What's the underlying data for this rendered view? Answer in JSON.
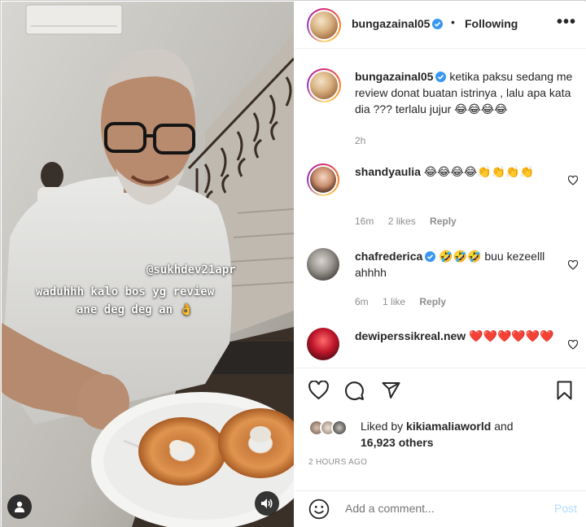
{
  "post": {
    "username": "bungazainal05",
    "follow_status": "Following",
    "dot": "•",
    "more": "•••"
  },
  "media": {
    "overlay_mention": "@sukhdev21apr",
    "overlay_line1": "waduhhh kalo bos yg review",
    "overlay_line2": "ane deg deg an 👌"
  },
  "caption": {
    "username": "bungazainal05",
    "text": "ketika paksu sedang me review donat buatan istrinya , lalu apa kata dia ??? terlalu jujur 😂😂😂😂",
    "time": "2h"
  },
  "comments": [
    {
      "username": "shandyaulia",
      "text": "😂😂😂😂👏👏👏👏",
      "time": "16m",
      "likes": "2 likes",
      "reply": "Reply"
    },
    {
      "username": "chafrederica",
      "text": "🤣🤣🤣 buu kezeelll ahhhh",
      "time": "6m",
      "likes": "1 like",
      "reply": "Reply"
    },
    {
      "username": "dewiperssikreal.new",
      "text": "❤️❤️❤️❤️❤️❤️"
    }
  ],
  "likes": {
    "prefix": "Liked by ",
    "user": "kikiamaliaworld",
    "middle": " and",
    "count": "16,923 others"
  },
  "time_ago": "2 HOURS AGO",
  "add_comment": {
    "placeholder": "Add a comment...",
    "post_label": "Post"
  },
  "colors": {
    "verified": "#3897f0",
    "muted": "#8e8e8e",
    "post_disabled": "#b3dbff"
  },
  "icons": [
    "heart-icon",
    "comment-icon",
    "share-icon",
    "bookmark-icon",
    "smile-icon",
    "user-icon",
    "sound-icon",
    "more-icon",
    "verified-icon"
  ]
}
